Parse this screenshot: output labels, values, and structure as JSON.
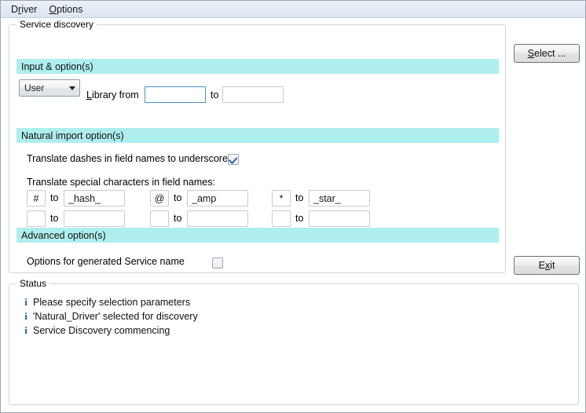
{
  "menu": {
    "items": [
      {
        "label": "Driver",
        "before": "D",
        "accel": "r",
        "after": "iver"
      },
      {
        "label": "Options",
        "before": "",
        "accel": "O",
        "after": "ptions"
      }
    ]
  },
  "service_discovery": {
    "group_label": "Service discovery",
    "sections": {
      "input": {
        "title": "Input & option(s)",
        "source_select": {
          "value": "User"
        },
        "library_from_label": {
          "accel": "L",
          "after": "ibrary from"
        },
        "library_from_value": "",
        "to_label": "to",
        "library_to_value": ""
      },
      "natural": {
        "title": "Natural import option(s)",
        "translate_dashes_label": "Translate dashes in field names to underscores",
        "translate_dashes_checked": true,
        "translate_special_label": "Translate special characters in field names:",
        "to_label": "to",
        "special_chars": [
          {
            "key": "#",
            "value": "_hash_"
          },
          {
            "key": "@",
            "value": "_amp"
          },
          {
            "key": "*",
            "value": "_star_"
          },
          {
            "key": "",
            "value": ""
          },
          {
            "key": "",
            "value": ""
          },
          {
            "key": "",
            "value": ""
          }
        ]
      },
      "advanced": {
        "title": "Advanced option(s)",
        "service_name_label": "Options for generated Service name",
        "service_name_checked": false
      }
    }
  },
  "buttons": {
    "select": {
      "accel": "S",
      "after": "elect ..."
    },
    "exit": {
      "before": "E",
      "accel": "x",
      "after": "it"
    }
  },
  "status": {
    "group_label": "Status",
    "icon": "i",
    "messages": [
      "Please specify selection parameters",
      "'Natural_Driver' selected for discovery",
      "Service Discovery commencing"
    ]
  },
  "colors": {
    "section_bar": "#afeeee",
    "info_icon": "#1c5aa8",
    "focus_border": "#4a90c4"
  }
}
